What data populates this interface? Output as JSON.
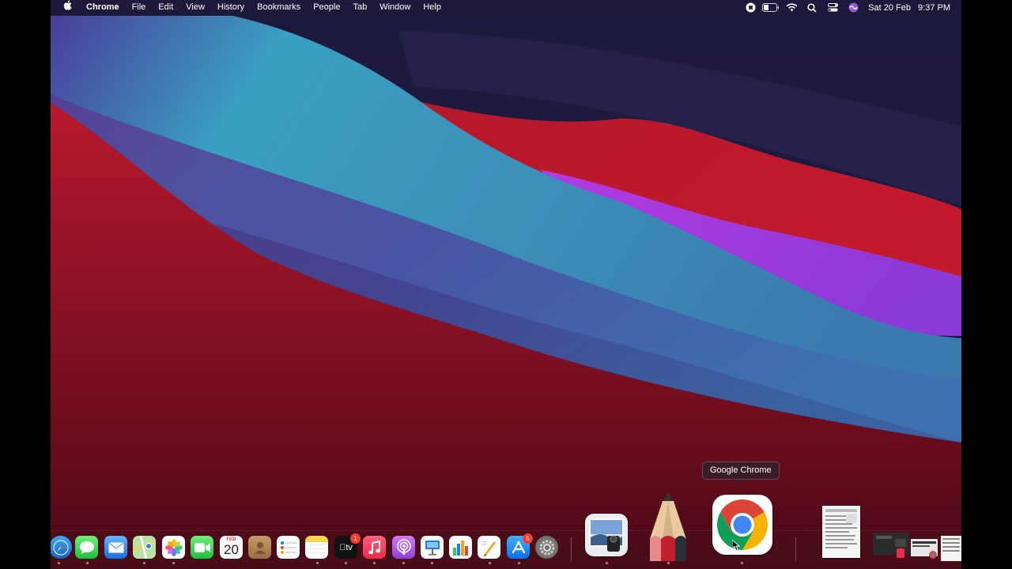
{
  "menubar": {
    "app_name": "Chrome",
    "menus": [
      "File",
      "Edit",
      "View",
      "History",
      "Bookmarks",
      "People",
      "Tab",
      "Window",
      "Help"
    ],
    "status_icons": [
      "screen-record-icon",
      "battery-icon",
      "wifi-icon",
      "spotlight-icon",
      "control-center-icon",
      "siri-icon"
    ],
    "date": "Sat 20 Feb",
    "time": "9:37 PM"
  },
  "tooltip": {
    "text": "Google Chrome"
  },
  "dock": {
    "apps": [
      "Safari",
      "Messages",
      "Mail",
      "Maps",
      "Photos",
      "FaceTime",
      "Calendar",
      "Contacts",
      "Reminders",
      "Notes",
      "TV",
      "Music",
      "Podcasts",
      "Keynote",
      "Numbers",
      "Pages",
      "App Store",
      "System Preferences"
    ],
    "calendar": {
      "month": "FEB",
      "day": "20"
    },
    "tv_label": "tv",
    "badges": {
      "tv": "1",
      "app_store": "5"
    },
    "recent_apps": [
      "Preview",
      "Sketch",
      "Google Chrome"
    ],
    "stack_items": [
      "document-thumbnail",
      "window-stack-thumbnail"
    ]
  },
  "colors": {
    "desktop_base": "#1c1a3c",
    "red_wave": "#b5182c",
    "cyan_wave": "#38a3c2",
    "purple_wave": "#8f3ad8"
  }
}
